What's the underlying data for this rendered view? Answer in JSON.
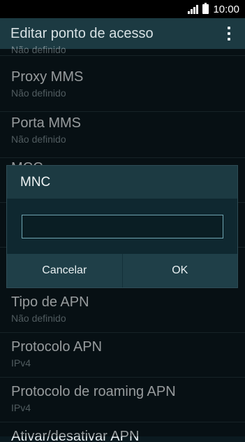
{
  "status_bar": {
    "time": "10:00"
  },
  "action_bar": {
    "title": "Editar ponto de acesso"
  },
  "list": [
    {
      "title": "",
      "subtitle": "Não definido"
    },
    {
      "title": "Proxy MMS",
      "subtitle": "Não definido"
    },
    {
      "title": "Porta MMS",
      "subtitle": "Não definido"
    },
    {
      "title": "MCC",
      "subtitle": ""
    },
    {
      "title": "",
      "subtitle": ""
    },
    {
      "title": "Tipo de APN",
      "subtitle": "Não definido"
    },
    {
      "title": "Protocolo APN",
      "subtitle": "IPv4"
    },
    {
      "title": "Protocolo de roaming APN",
      "subtitle": "IPv4"
    },
    {
      "title": "Ativar/desativar APN",
      "subtitle": ""
    }
  ],
  "dialog": {
    "title": "MNC",
    "input_value": "",
    "cancel_label": "Cancelar",
    "ok_label": "OK"
  }
}
